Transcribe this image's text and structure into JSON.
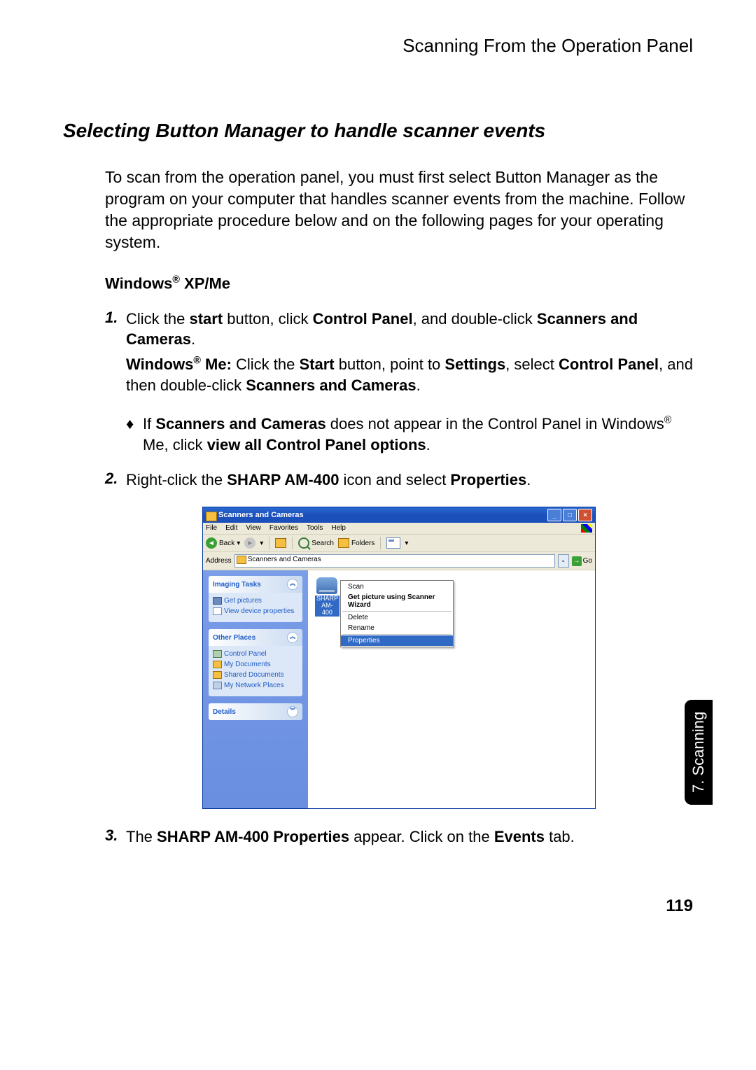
{
  "header_topic": "Scanning From the Operation Panel",
  "section_title": "Selecting Button Manager to handle scanner events",
  "intro": "To scan from the operation panel, you must first select Button Manager as the program on your computer that handles scanner events from the machine. Follow the appropriate procedure below and on the following pages for your operating system.",
  "os_heading_prefix": "Windows",
  "os_heading_suffix": " XP/Me",
  "registered": "®",
  "step1": {
    "num": "1.",
    "p1_a": "Click the ",
    "p1_b": "start",
    "p1_c": " button, click ",
    "p1_d": "Control Panel",
    "p1_e": ", and double-click ",
    "p1_f": "Scanners and Cameras",
    "p1_g": ".",
    "p2_a": "Windows",
    "p2_b": " Me:",
    "p2_c": " Click the ",
    "p2_d": "Start",
    "p2_e": " button, point to ",
    "p2_f": "Settings",
    "p2_g": ", select ",
    "p2_h": "Control Panel",
    "p2_i": ", and then double-click ",
    "p2_j": "Scanners and Cameras",
    "p2_k": "."
  },
  "bullet": {
    "sym": "♦",
    "a": "If ",
    "b": "Scanners and Cameras",
    "c": " does not appear in the Control Panel in Windows",
    "d": " Me, click ",
    "e": "view all Control Panel options",
    "f": "."
  },
  "step2": {
    "num": "2.",
    "a": "Right-click the ",
    "b": "SHARP AM-400",
    "c": " icon and select ",
    "d": "Properties",
    "e": "."
  },
  "step3": {
    "num": "3.",
    "a": "The ",
    "b": "SHARP AM-400 Properties",
    "c": " appear. Click on the ",
    "d": "Events",
    "e": " tab."
  },
  "xp": {
    "title": "Scanners and Cameras",
    "min": "_",
    "max": "□",
    "close": "×",
    "menus": [
      "File",
      "Edit",
      "View",
      "Favorites",
      "Tools",
      "Help"
    ],
    "back": "Back",
    "dd": "▾",
    "search": "Search",
    "folders": "Folders",
    "addr_label": "Address",
    "addr_value": "Scanners and Cameras",
    "addr_dd": "⌄",
    "go": "Go",
    "side1_title": "Imaging Tasks",
    "side1_items": [
      "Get pictures",
      "View device properties"
    ],
    "side2_title": "Other Places",
    "side2_items": [
      "Control Panel",
      "My Documents",
      "Shared Documents",
      "My Network Places"
    ],
    "side3_title": "Details",
    "collapse_up": "︽",
    "collapse_down": "︾",
    "device_label": "SHARP AM-400",
    "ctx": {
      "scan": "Scan",
      "wizard": "Get picture using Scanner Wizard",
      "delete": "Delete",
      "rename": "Rename",
      "properties": "Properties"
    }
  },
  "side_tab": "7. Scanning",
  "page_number": "119"
}
